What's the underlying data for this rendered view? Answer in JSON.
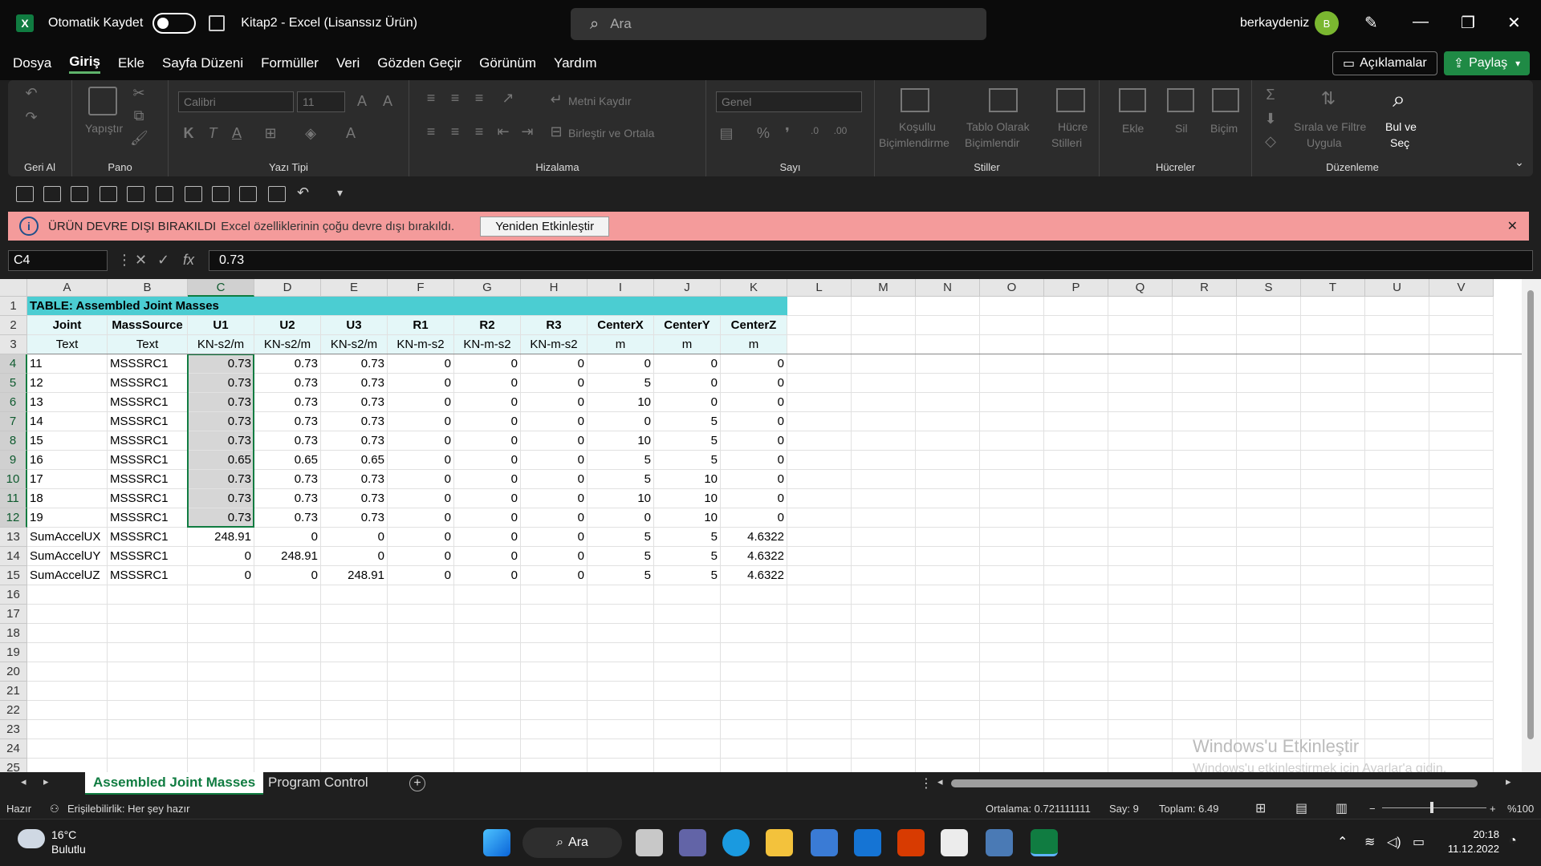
{
  "titlebar": {
    "autosave_label": "Otomatik Kaydet",
    "doc_title": "Kitap2 -  Excel (Lisanssız Ürün)",
    "search_placeholder": "Ara",
    "user_name": "berkaydeniz",
    "avatar_initial": "B"
  },
  "menu": {
    "items": [
      "Dosya",
      "Giriş",
      "Ekle",
      "Sayfa Düzeni",
      "Formüller",
      "Veri",
      "Gözden Geçir",
      "Görünüm",
      "Yardım"
    ],
    "active": "Giriş",
    "comments_label": "Açıklamalar",
    "share_label": "Paylaş"
  },
  "ribbon": {
    "undo_group": "Geri Al",
    "clipboard_group": "Pano",
    "paste_label": "Yapıştır",
    "font_group": "Yazı Tipi",
    "font_name": "Calibri",
    "font_size": "11",
    "alignment_group": "Hizalama",
    "wrap_text": "Metni Kaydır",
    "merge_center": "Birleştir ve Ortala",
    "number_group": "Sayı",
    "number_format": "Genel",
    "styles_group": "Stiller",
    "cond_format_1": "Koşullu",
    "cond_format_2": "Biçimlendirme",
    "format_table_1": "Tablo Olarak",
    "format_table_2": "Biçimlendir",
    "cell_styles_1": "Hücre",
    "cell_styles_2": "Stilleri",
    "cells_group": "Hücreler",
    "insert": "Ekle",
    "delete": "Sil",
    "format": "Biçim",
    "editing_group": "Düzenleme",
    "sort_filter_1": "Sırala ve Filtre",
    "sort_filter_2": "Uygula",
    "find_select_1": "Bul ve",
    "find_select_2": "Seç"
  },
  "notice": {
    "title": "ÜRÜN DEVRE DIŞI BIRAKILDI",
    "desc": "Excel özelliklerinin çoğu devre dışı bırakıldı.",
    "button": "Yeniden Etkinleştir"
  },
  "formula_bar": {
    "name_box": "C4",
    "value": "0.73"
  },
  "grid": {
    "columns": [
      "A",
      "B",
      "C",
      "D",
      "E",
      "F",
      "G",
      "H",
      "I",
      "J",
      "K",
      "L",
      "M",
      "N",
      "O",
      "P",
      "Q",
      "R",
      "S",
      "T",
      "U",
      "V"
    ],
    "row_numbers": [
      "1",
      "2",
      "3",
      "4",
      "5",
      "6",
      "7",
      "8",
      "9",
      "10",
      "11",
      "12",
      "13",
      "14",
      "15",
      "16",
      "17",
      "18",
      "19",
      "20",
      "21",
      "22",
      "23",
      "24",
      "25"
    ],
    "table_title": "TABLE:  Assembled Joint Masses",
    "headers": [
      "Joint",
      "MassSource",
      "U1",
      "U2",
      "U3",
      "R1",
      "R2",
      "R3",
      "CenterX",
      "CenterY",
      "CenterZ"
    ],
    "units": [
      "Text",
      "Text",
      "KN-s2/m",
      "KN-s2/m",
      "KN-s2/m",
      "KN-m-s2",
      "KN-m-s2",
      "KN-m-s2",
      "m",
      "m",
      "m"
    ],
    "rows": [
      [
        "11",
        "MSSSRC1",
        "0.73",
        "0.73",
        "0.73",
        "0",
        "0",
        "0",
        "0",
        "0",
        "0"
      ],
      [
        "12",
        "MSSSRC1",
        "0.73",
        "0.73",
        "0.73",
        "0",
        "0",
        "0",
        "5",
        "0",
        "0"
      ],
      [
        "13",
        "MSSSRC1",
        "0.73",
        "0.73",
        "0.73",
        "0",
        "0",
        "0",
        "10",
        "0",
        "0"
      ],
      [
        "14",
        "MSSSRC1",
        "0.73",
        "0.73",
        "0.73",
        "0",
        "0",
        "0",
        "0",
        "5",
        "0"
      ],
      [
        "15",
        "MSSSRC1",
        "0.73",
        "0.73",
        "0.73",
        "0",
        "0",
        "0",
        "10",
        "5",
        "0"
      ],
      [
        "16",
        "MSSSRC1",
        "0.65",
        "0.65",
        "0.65",
        "0",
        "0",
        "0",
        "5",
        "5",
        "0"
      ],
      [
        "17",
        "MSSSRC1",
        "0.73",
        "0.73",
        "0.73",
        "0",
        "0",
        "0",
        "5",
        "10",
        "0"
      ],
      [
        "18",
        "MSSSRC1",
        "0.73",
        "0.73",
        "0.73",
        "0",
        "0",
        "0",
        "10",
        "10",
        "0"
      ],
      [
        "19",
        "MSSSRC1",
        "0.73",
        "0.73",
        "0.73",
        "0",
        "0",
        "0",
        "0",
        "10",
        "0"
      ],
      [
        "SumAccelUX",
        "MSSSRC1",
        "248.91",
        "0",
        "0",
        "0",
        "0",
        "0",
        "5",
        "5",
        "4.6322"
      ],
      [
        "SumAccelUY",
        "MSSSRC1",
        "0",
        "248.91",
        "0",
        "0",
        "0",
        "0",
        "5",
        "5",
        "4.6322"
      ],
      [
        "SumAccelUZ",
        "MSSSRC1",
        "0",
        "0",
        "248.91",
        "0",
        "0",
        "0",
        "5",
        "5",
        "4.6322"
      ]
    ],
    "watermark_title": "Windows'u Etkinleştir",
    "watermark_sub": "Windows'u etkinleştirmek için Ayarlar'a gidin."
  },
  "sheets": {
    "tabs": [
      "Assembled Joint Masses",
      "Program Control"
    ],
    "active": "Assembled Joint Masses"
  },
  "status": {
    "ready": "Hazır",
    "accessibility": "Erişilebilirlik: Her şey hazır",
    "average": "Ortalama: 0.721111111",
    "count": "Say: 9",
    "sum": "Toplam: 6.49",
    "zoom": "%100"
  },
  "taskbar": {
    "temp": "16°C",
    "weather": "Bulutlu",
    "search": "Ara",
    "time": "20:18",
    "date": "11.12.2022"
  },
  "colors": {
    "excel_green": "#107c41",
    "table_header_teal": "#4bcdd2",
    "notice_bg": "#f49b9b"
  }
}
